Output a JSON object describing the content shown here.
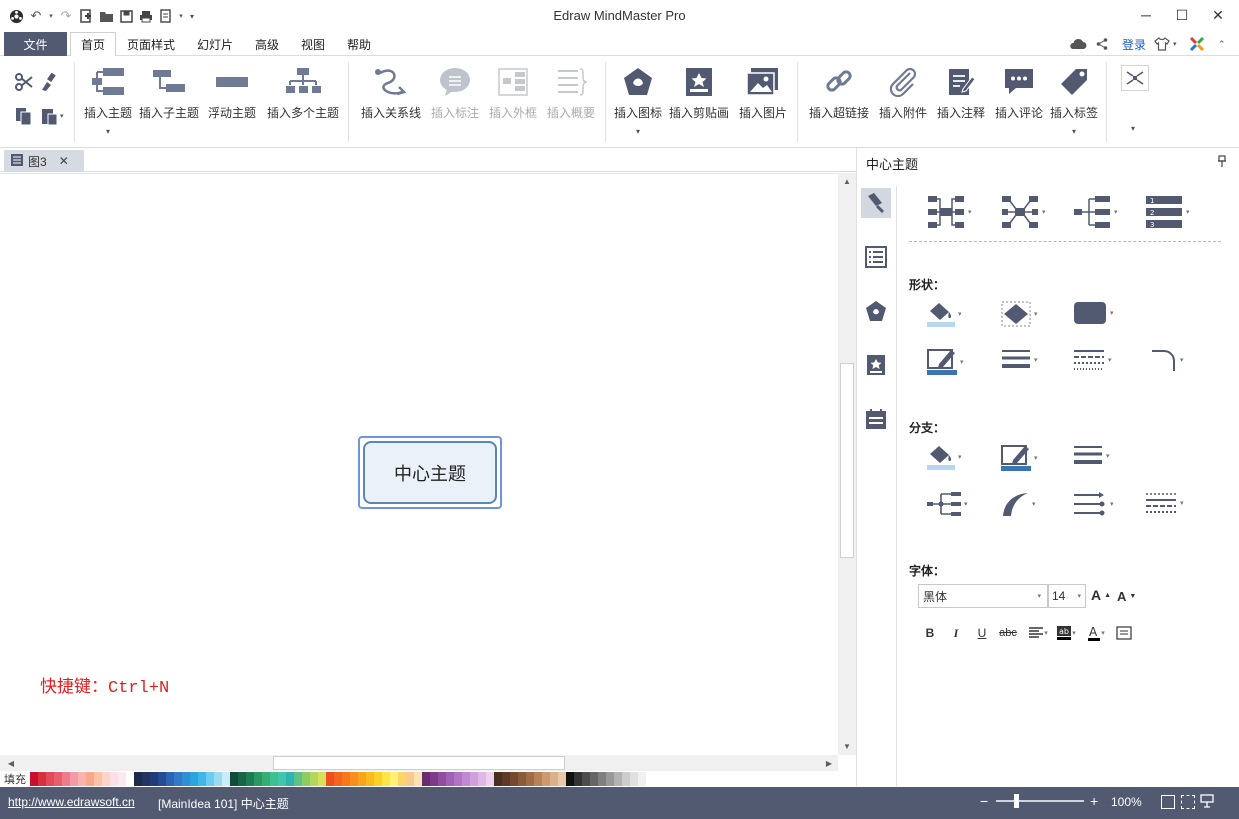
{
  "window": {
    "title": "Edraw MindMaster Pro"
  },
  "menu": {
    "file": "文件",
    "tabs": [
      "首页",
      "页面样式",
      "幻灯片",
      "高级",
      "视图",
      "帮助"
    ],
    "login": "登录"
  },
  "ribbon": {
    "insert_topic": "插入主题",
    "insert_subtopic": "插入子主题",
    "floating_topic": "浮动主题",
    "insert_multiple": "插入多个主题",
    "insert_relation": "插入关系线",
    "insert_callout": "插入标注",
    "insert_boundary": "插入外框",
    "insert_summary": "插入概要",
    "insert_icon": "插入图标",
    "insert_clipart": "插入剪贴画",
    "insert_image": "插入图片",
    "insert_hyperlink": "插入超链接",
    "insert_attachment": "插入附件",
    "insert_note": "插入注释",
    "insert_comment": "插入评论",
    "insert_tag": "插入标签"
  },
  "document": {
    "tab_name": "图3"
  },
  "canvas": {
    "central_topic": "中心主题",
    "shortcut_hint": "快捷键：Ctrl+N"
  },
  "palette": {
    "fill_label": "填充",
    "colors": [
      "#c8102e",
      "#d6303c",
      "#e04a5a",
      "#e85d6a",
      "#ee7b8c",
      "#f29aa8",
      "#f7b3b0",
      "#f9a98a",
      "#fbc2a6",
      "#fcd5c4",
      "#fde0e6",
      "#fbe9ef",
      "#ffffff",
      "#1d2a4d",
      "#23355f",
      "#1e3d7a",
      "#254c93",
      "#2c63b3",
      "#3478c9",
      "#2f8fd6",
      "#2aa4df",
      "#3eb7e8",
      "#6ccbf0",
      "#9adbf4",
      "#c8ecf9",
      "#0f4d3a",
      "#176547",
      "#1f7d55",
      "#2a9863",
      "#37ad73",
      "#3dbf93",
      "#40c7aa",
      "#2fb5b0",
      "#5fc08a",
      "#8ccd63",
      "#b3d65b",
      "#d6e05a",
      "#f04e1e",
      "#f3641d",
      "#f5791b",
      "#f78f1a",
      "#f9a51b",
      "#fbbb1e",
      "#fdd123",
      "#fee34a",
      "#fff176",
      "#fbd46a",
      "#f9c98e",
      "#fbe2b5",
      "#6a2c70",
      "#7d3a87",
      "#8e4d9f",
      "#a060b3",
      "#b173c4",
      "#c189d1",
      "#d09fdc",
      "#dfb8e6",
      "#ecd2f0",
      "#4a2e1f",
      "#5d3a27",
      "#73492f",
      "#8a5a3a",
      "#a06c47",
      "#b88158",
      "#cc9a70",
      "#dcb08a",
      "#e9c8a9",
      "#111111",
      "#333333",
      "#4d4d4d",
      "#666666",
      "#808080",
      "#999999",
      "#b3b3b3",
      "#cccccc",
      "#e0e0e0",
      "#f0f0f0"
    ]
  },
  "side_panel": {
    "title": "中心主题",
    "shape_label": "形状：",
    "branch_label": "分支：",
    "font_label": "字体：",
    "font_family": "黑体",
    "font_size": "14",
    "bold": "B",
    "italic": "I",
    "underline": "U",
    "strike": "abc"
  },
  "status": {
    "url": "http://www.edrawsoft.cn",
    "info": "[MainIdea 101]  中心主题",
    "zoom": "100%"
  },
  "accent_colors": {
    "file_tab": "#525a72",
    "statusbar": "#525a72",
    "topic_border": "#5c86b4",
    "topic_fill": "#eaf1f9",
    "shortcut": "#e02020",
    "login_link": "#1a5fc4"
  }
}
